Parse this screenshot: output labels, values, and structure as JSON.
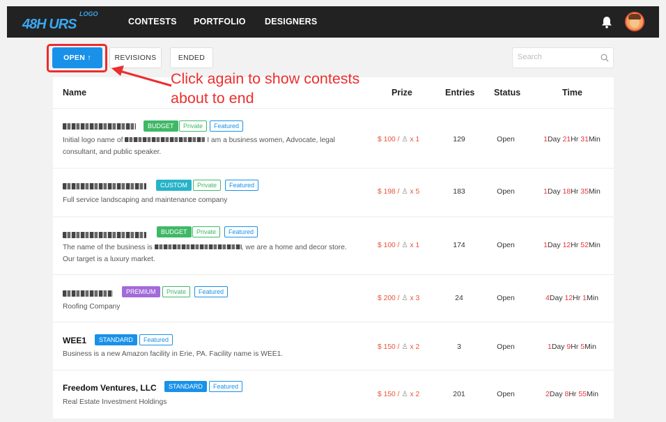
{
  "header": {
    "logo_main": "48H  URS",
    "logo_sup": "LOGO",
    "nav": [
      "CONTESTS",
      "PORTFOLIO",
      "DESIGNERS"
    ]
  },
  "tabs": {
    "open": "OPEN ↑",
    "revisions": "REVISIONS",
    "ended": "ENDED"
  },
  "search": {
    "placeholder": "Search"
  },
  "annotation": {
    "line1": "Click again to show contests",
    "line2": "about to end"
  },
  "columns": {
    "name": "Name",
    "prize": "Prize",
    "entries": "Entries",
    "status": "Status",
    "time": "Time"
  },
  "rows": [
    {
      "title": "",
      "badges": [
        "BUDGET",
        "Private",
        "Featured"
      ],
      "desc_pre": "Initial logo name of",
      "desc_post": "I am a business women, Advocate, legal consultant, and public speaker.",
      "prize_amount": "$ 100 /",
      "prize_count": "x 1",
      "entries": "129",
      "status": "Open",
      "t1": "1",
      "t2": "Day ",
      "t3": "21",
      "t4": "Hr ",
      "t5": "31",
      "t6": "Min"
    },
    {
      "title": "",
      "badges": [
        "CUSTOM",
        "Private",
        "Featured"
      ],
      "desc_pre": "Full service landscaping and maintenance company",
      "desc_post": "",
      "prize_amount": "$ 198 /",
      "prize_count": "x 5",
      "entries": "183",
      "status": "Open",
      "t1": "1",
      "t2": "Day ",
      "t3": "18",
      "t4": "Hr ",
      "t5": "35",
      "t6": "Min"
    },
    {
      "title": "",
      "badges": [
        "BUDGET",
        "Private",
        "Featured"
      ],
      "desc_pre": "The name of the business is",
      "desc_post": ", we are a home and decor store. Our target is a luxury market.",
      "prize_amount": "$ 100 /",
      "prize_count": "x 1",
      "entries": "174",
      "status": "Open",
      "t1": "1",
      "t2": "Day ",
      "t3": "12",
      "t4": "Hr ",
      "t5": "52",
      "t6": "Min"
    },
    {
      "title": "",
      "badges": [
        "PREMIUM",
        "Private",
        "Featured"
      ],
      "desc_pre": "Roofing Company",
      "desc_post": "",
      "prize_amount": "$ 200 /",
      "prize_count": "x 3",
      "entries": "24",
      "status": "Open",
      "t1": "4",
      "t2": "Day ",
      "t3": "12",
      "t4": "Hr ",
      "t5": "1",
      "t6": "Min"
    },
    {
      "title": "WEE1",
      "badges": [
        "STANDARD",
        "Featured"
      ],
      "desc_pre": "Business is a new Amazon facility in Erie, PA. Facility name is WEE1.",
      "desc_post": "",
      "prize_amount": "$ 150 /",
      "prize_count": "x 2",
      "entries": "3",
      "status": "Open",
      "t1": "1",
      "t2": "Day ",
      "t3": "9",
      "t4": "Hr ",
      "t5": "5",
      "t6": "Min"
    },
    {
      "title": "Freedom Ventures, LLC",
      "badges": [
        "STANDARD",
        "Featured"
      ],
      "desc_pre": "Real Estate Investment Holdings",
      "desc_post": "",
      "prize_amount": "$ 150 /",
      "prize_count": "x 2",
      "entries": "201",
      "status": "Open",
      "t1": "2",
      "t2": "Day ",
      "t3": "8",
      "t4": "Hr ",
      "t5": "55",
      "t6": "Min"
    }
  ]
}
